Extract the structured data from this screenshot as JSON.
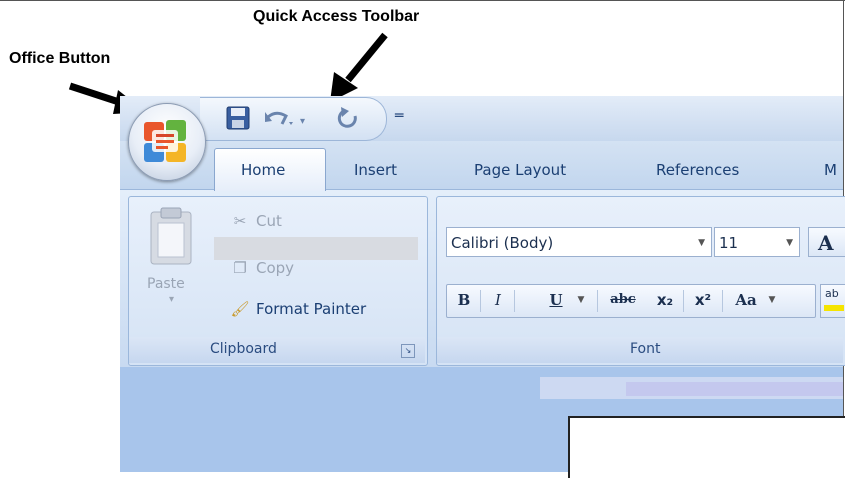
{
  "callouts": {
    "quick_access": "Quick Access Toolbar",
    "office_button": "Office Button"
  },
  "tabs": [
    {
      "label": "Home",
      "active": true
    },
    {
      "label": "Insert"
    },
    {
      "label": "Page Layout"
    },
    {
      "label": "References"
    },
    {
      "label": "M"
    }
  ],
  "clipboard": {
    "paste_label": "Paste",
    "cut_label": "Cut",
    "copy_label": "Copy",
    "format_painter_label": "Format Painter",
    "group_label": "Clipboard"
  },
  "font": {
    "font_name": "Calibri (Body)",
    "font_size": "11",
    "grow_label": "A",
    "group_label": "Font",
    "buttons": {
      "bold": "B",
      "italic": "I",
      "underline": "U",
      "strike": "abc",
      "subscript": "x₂",
      "superscript": "x²",
      "change_case": "Aa",
      "highlight": "ab"
    }
  },
  "icons": {
    "office_logo": "office-logo-icon",
    "save": "save-icon",
    "undo": "undo-icon",
    "redo": "redo-icon",
    "customize": "customize-qat-icon",
    "paste": "paste-icon",
    "cut": "scissors-icon",
    "copy": "copy-icon",
    "format_painter": "paintbrush-icon",
    "dialog_launcher": "dialog-launcher-icon"
  },
  "colors": {
    "ribbon_blue": "#c8daf1",
    "tab_text": "#1b3f73",
    "document_bg": "#a8c5eb"
  }
}
